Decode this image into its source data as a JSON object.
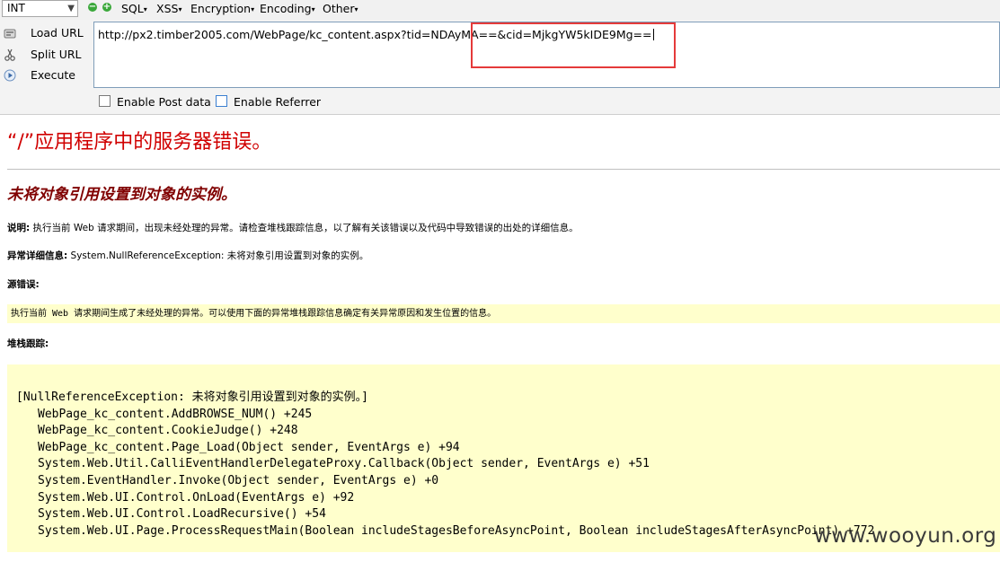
{
  "toolbar": {
    "select_value": "INT",
    "menus": [
      {
        "label": "SQL"
      },
      {
        "label": "XSS"
      },
      {
        "label": "Encryption"
      },
      {
        "label": "Encoding"
      },
      {
        "label": "Other"
      }
    ]
  },
  "side": {
    "load_url": "Load URL",
    "split_url": "Split URL",
    "execute": "Execute"
  },
  "url": {
    "value": "http://px2.timber2005.com/WebPage/kc_content.aspx?tid=NDAyMA==&cid=MjkgYW5kIDE9Mg=="
  },
  "options": {
    "post": "Enable Post data",
    "referrer": "Enable Referrer"
  },
  "error": {
    "title": "“/”应用程序中的服务器错误。",
    "subtitle": "未将对象引用设置到对象的实例。",
    "desc_label": "说明:",
    "desc_text": " 执行当前 Web 请求期间，出现未经处理的异常。请检查堆栈跟踪信息，以了解有关该错误以及代码中导致错误的出处的详细信息。",
    "detail_label": "异常详细信息:",
    "detail_text": " System.NullReferenceException: 未将对象引用设置到对象的实例。",
    "source_label": "源错误:",
    "source_text": "执行当前 Web 请求期间生成了未经处理的异常。可以使用下面的异常堆栈跟踪信息确定有关异常原因和发生位置的信息。",
    "stack_label": "堆栈跟踪:"
  },
  "stack": {
    "header": "[NullReferenceException: 未将对象引用设置到对象的实例。]",
    "lines": [
      "WebPage_kc_content.AddBROWSE_NUM() +245",
      "WebPage_kc_content.CookieJudge() +248",
      "WebPage_kc_content.Page_Load(Object sender, EventArgs e) +94",
      "System.Web.Util.CalliEventHandlerDelegateProxy.Callback(Object sender, EventArgs e) +51",
      "System.EventHandler.Invoke(Object sender, EventArgs e) +0",
      "System.Web.UI.Control.OnLoad(EventArgs e) +92",
      "System.Web.UI.Control.LoadRecursive() +54",
      "System.Web.UI.Page.ProcessRequestMain(Boolean includeStagesBeforeAsyncPoint, Boolean includeStagesAfterAsyncPoint) +772"
    ]
  },
  "watermark": "www.wooyun.org",
  "colors": {
    "error_red": "#d00000",
    "subtitle_maroon": "#800000",
    "highlight_box": "#e53a3a",
    "code_bg": "#ffffcc"
  }
}
